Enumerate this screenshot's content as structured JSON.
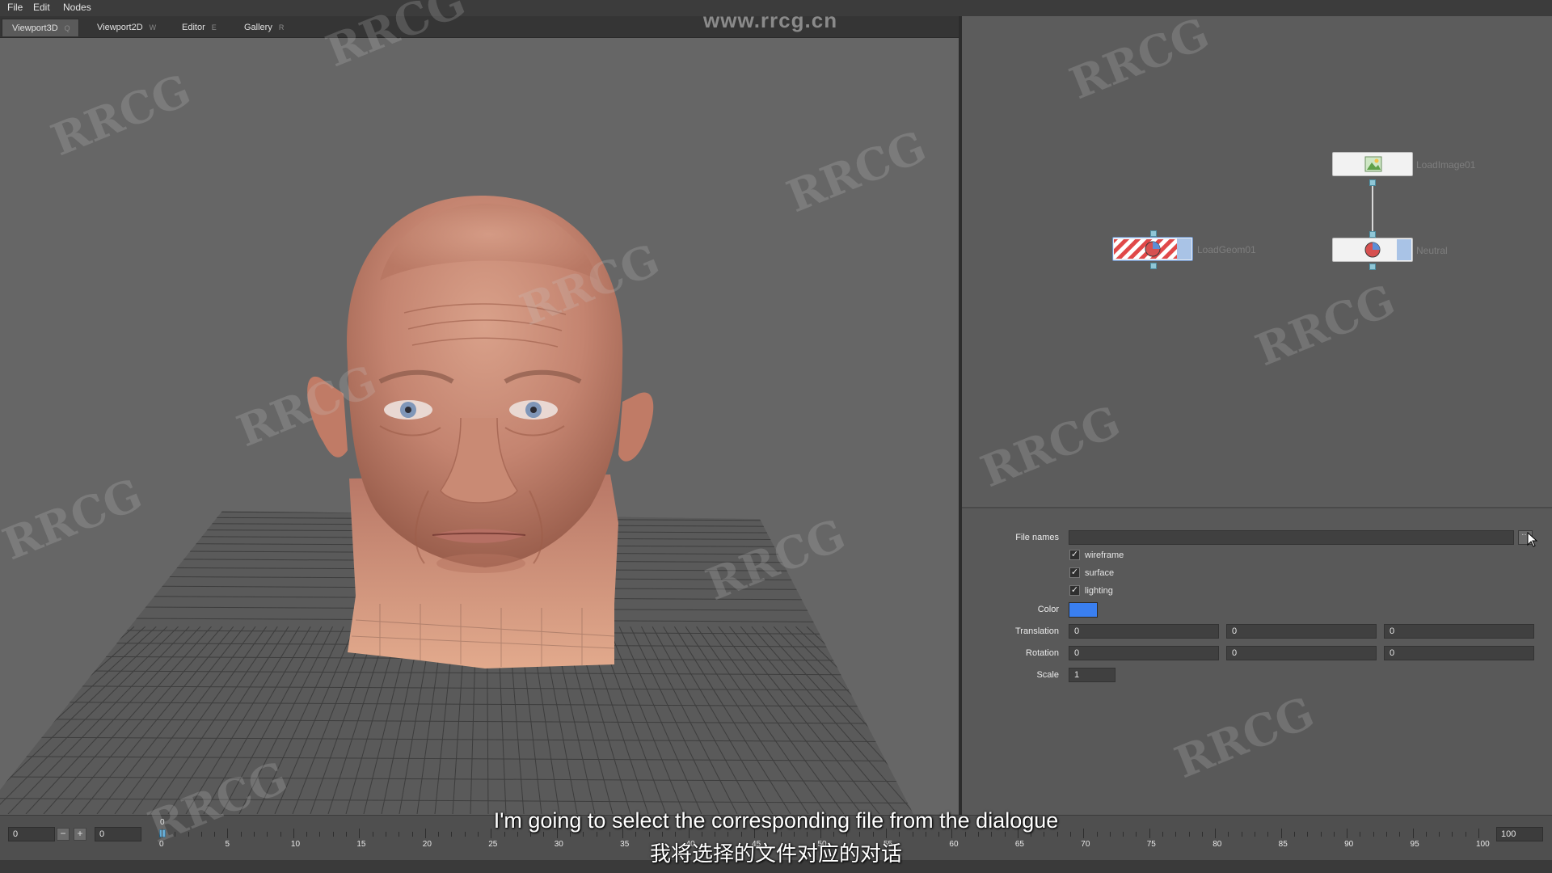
{
  "menu": {
    "items": [
      "File",
      "Edit",
      "Nodes"
    ]
  },
  "tabs": [
    {
      "label": "Viewport3D",
      "shortcut": "Q",
      "active": true
    },
    {
      "label": "Viewport2D",
      "shortcut": "W",
      "active": false
    },
    {
      "label": "Editor",
      "shortcut": "E",
      "active": false
    },
    {
      "label": "Gallery",
      "shortcut": "R",
      "active": false
    }
  ],
  "watermark": {
    "url": "www.rrcg.cn",
    "text": "RRCG"
  },
  "node_graph": {
    "nodes": [
      {
        "id": "loadimage",
        "label": "LoadImage01",
        "icon": "image-icon"
      },
      {
        "id": "loadgeom",
        "label": "LoadGeom01",
        "icon": "geometry-icon"
      },
      {
        "id": "neutral",
        "label": "Neutral",
        "icon": "geometry-icon"
      }
    ]
  },
  "properties": {
    "file_names_label": "File names",
    "file_names_value": "",
    "browse_icon": "browse-icon",
    "wireframe": {
      "label": "wireframe",
      "checked": true
    },
    "surface": {
      "label": "surface",
      "checked": true
    },
    "lighting": {
      "label": "lighting",
      "checked": true
    },
    "color_label": "Color",
    "color_value": "#3a7ff0",
    "translation": {
      "label": "Translation",
      "x": "0",
      "y": "0",
      "z": "0"
    },
    "rotation": {
      "label": "Rotation",
      "x": "0",
      "y": "0",
      "z": "0"
    },
    "scale": {
      "label": "Scale",
      "value": "1"
    }
  },
  "timeline": {
    "start_value": "0",
    "current_value": "0",
    "end_value": "100",
    "playhead": "0",
    "minus_label": "−",
    "plus_label": "+",
    "ticks": [
      "0",
      "5",
      "10",
      "15",
      "20",
      "25",
      "30",
      "35",
      "40",
      "45",
      "50",
      "55",
      "60",
      "65",
      "70",
      "75",
      "80",
      "85",
      "90",
      "95",
      "100"
    ]
  },
  "subtitles": {
    "english": "I'm going to select the corresponding file from the dialogue",
    "chinese": "我将选择的文件对应的对话"
  }
}
